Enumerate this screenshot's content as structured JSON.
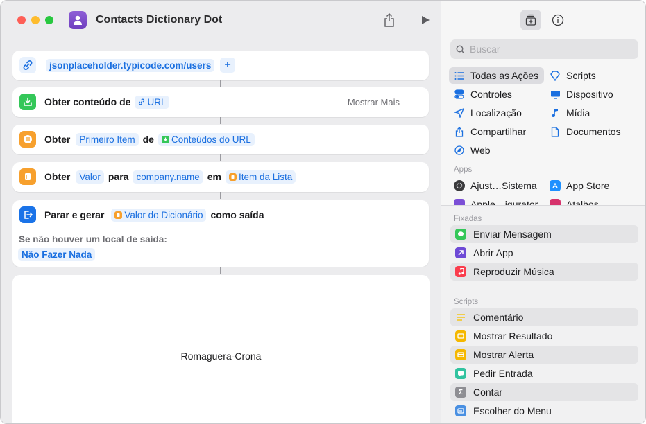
{
  "window": {
    "title": "Contacts Dictionary Dot"
  },
  "editor": {
    "url_action": {
      "url": "jsonplaceholder.typicode.com/users",
      "add_symbol": "+"
    },
    "get_contents": {
      "label": "Obter conteúdo de",
      "url_token": "URL",
      "show_more": "Mostrar Mais"
    },
    "get_item": {
      "label": "Obter",
      "item_token": "Primeiro Item",
      "from_label": "de",
      "source_token": "Conteúdos do URL"
    },
    "get_value": {
      "label": "Obter",
      "value_token": "Valor",
      "for_label": "para",
      "key_token": "company.name",
      "in_label": "em",
      "source_token": "Item da Lista"
    },
    "stop_output": {
      "label": "Parar e gerar",
      "value_token": "Valor do Dicionário",
      "suffix": "como saída",
      "fallback_label": "Se não houver um local de saída:",
      "fallback_token": "Não Fazer Nada"
    },
    "output": {
      "text": "Romaguera-Crona"
    }
  },
  "library": {
    "search_placeholder": "Buscar",
    "categories": [
      {
        "label": "Todas as Ações",
        "icon": "list-icon",
        "selected": true
      },
      {
        "label": "Scripts",
        "icon": "scripts-icon"
      },
      {
        "label": "Controles",
        "icon": "toggle-icon"
      },
      {
        "label": "Dispositivo",
        "icon": "display-icon"
      },
      {
        "label": "Localização",
        "icon": "location-icon"
      },
      {
        "label": "Mídia",
        "icon": "music-note-icon"
      },
      {
        "label": "Compartilhar",
        "icon": "share-icon"
      },
      {
        "label": "Documentos",
        "icon": "document-icon"
      },
      {
        "label": "Web",
        "icon": "compass-icon"
      }
    ],
    "apps_header": "Apps",
    "apps": [
      {
        "label": "Ajust…Sistema",
        "icon": "gear-icon",
        "color": "#3a3a3c"
      },
      {
        "label": "App Store",
        "icon": "app-store-icon",
        "color": "#1e90ff"
      },
      {
        "label": "Apple…igurator",
        "icon": "configurator-icon",
        "color": "#7b4fd6"
      },
      {
        "label": "Atalhos",
        "icon": "shortcuts-icon",
        "color": "#d6336c"
      }
    ],
    "pinned_header": "Fixadas",
    "pinned": [
      {
        "label": "Enviar Mensagem",
        "icon": "message-icon",
        "color": "#34c759"
      },
      {
        "label": "Abrir App",
        "icon": "open-app-icon",
        "color": "#6e4ad6"
      },
      {
        "label": "Reproduzir Música",
        "icon": "music-icon",
        "color": "#fa3c4c"
      }
    ],
    "scripts_header": "Scripts",
    "scripts": [
      {
        "label": "Comentário",
        "icon": "comment-icon",
        "color": "#f5c518"
      },
      {
        "label": "Mostrar Resultado",
        "icon": "result-icon",
        "color": "#f5b800"
      },
      {
        "label": "Mostrar Alerta",
        "icon": "alert-icon",
        "color": "#f5b800"
      },
      {
        "label": "Pedir Entrada",
        "icon": "input-icon",
        "color": "#32c3a0"
      },
      {
        "label": "Contar",
        "icon": "sigma-icon",
        "color": "#8e8e93"
      },
      {
        "label": "Escolher do Menu",
        "icon": "menu-icon",
        "color": "#4a90e2"
      }
    ]
  }
}
